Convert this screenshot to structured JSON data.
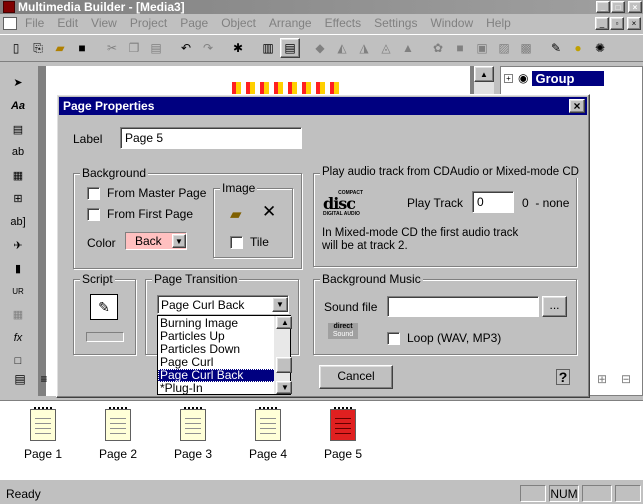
{
  "app": {
    "title": "Multimedia Builder - [Media3]",
    "window_controls": [
      "_",
      "□",
      "×"
    ],
    "doc_controls": [
      "_",
      "▫",
      "×"
    ]
  },
  "menu": [
    "File",
    "Edit",
    "View",
    "Project",
    "Page",
    "Object",
    "Arrange",
    "Effects",
    "Settings",
    "Window",
    "Help"
  ],
  "group_panel": {
    "title": "Group"
  },
  "dialog": {
    "title": "Page Properties",
    "close": "×",
    "label_caption": "Label",
    "label_value": "Page 5",
    "background": {
      "title": "Background",
      "from_master": "From Master Page",
      "from_first": "From First Page",
      "color_label": "Color",
      "color_value": "Back",
      "image_title": "Image",
      "tile": "Tile"
    },
    "cd": {
      "title": "Play audio track from CDAudio or Mixed-mode CD",
      "logo_top": "COMPACT",
      "logo_main": "disc",
      "logo_bottom": "DIGITAL AUDIO",
      "play_track_label": "Play Track",
      "play_track_value": "0",
      "track_note": "0  - none",
      "info_line1": "In Mixed-mode CD the first audio track",
      "info_line2": "will be at track 2."
    },
    "script": {
      "title": "Script"
    },
    "transition": {
      "title": "Page Transition",
      "selected": "Page Curl Back",
      "options": [
        "Burning Image",
        "Particles Up",
        "Particles Down",
        "Page Curl",
        "Page Curl Back",
        "*Plug-In"
      ],
      "highlighted_index": 4
    },
    "music": {
      "title": "Background Music",
      "sound_file_label": "Sound file",
      "sound_file_value": "",
      "browse": "...",
      "direct_top": "direct",
      "direct_bottom": "Sound",
      "loop": "Loop (WAV, MP3)"
    },
    "cancel": "Cancel",
    "help": "?"
  },
  "pages": [
    {
      "label": "Page 1",
      "active": false
    },
    {
      "label": "Page 2",
      "active": false
    },
    {
      "label": "Page 3",
      "active": false
    },
    {
      "label": "Page 4",
      "active": false
    },
    {
      "label": "Page 5",
      "active": true
    }
  ],
  "status": {
    "text": "Ready",
    "num": "NUM"
  },
  "colors": {
    "titlebar": "#000080",
    "face": "#c0c0c0",
    "selection": "#000080",
    "active_page": "#e02020"
  }
}
